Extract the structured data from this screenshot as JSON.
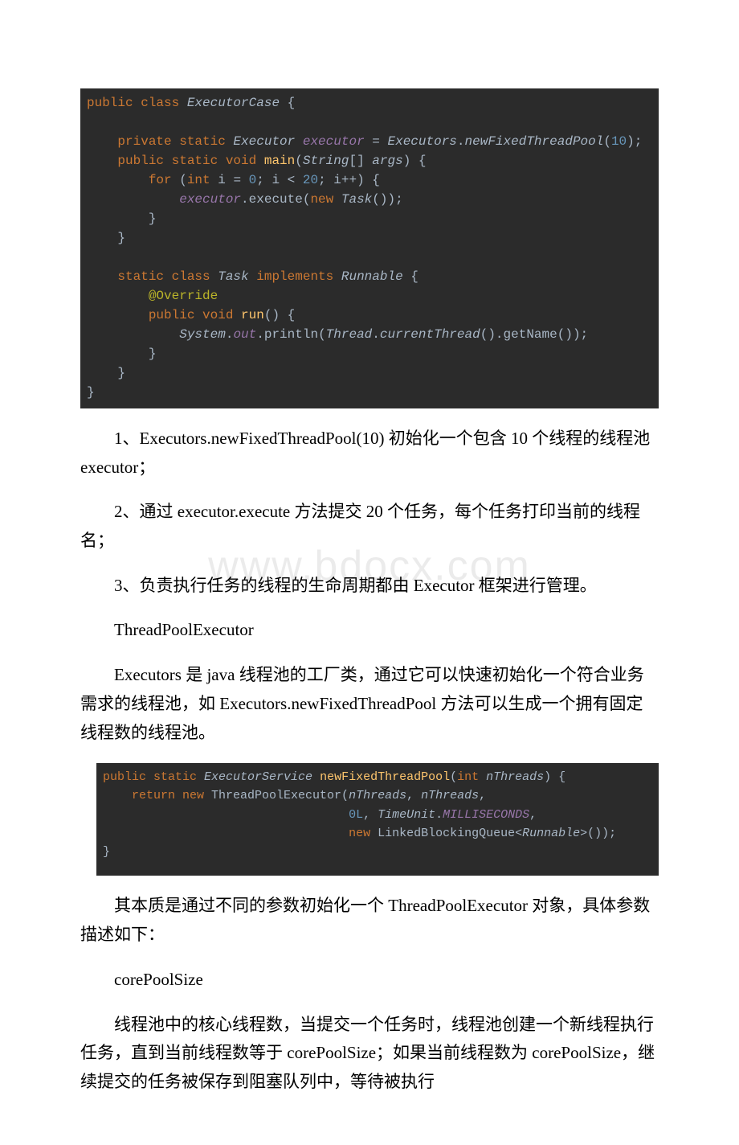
{
  "watermark": "www.bdocx.com",
  "code1": {
    "l1_kw": "public class",
    "l1_cls": " ExecutorCase",
    "l1_rest": " {",
    "l3_kw1": "private static",
    "l3_type": " Executor",
    "l3_var": " executor",
    "l3_eq": " = ",
    "l3_cls": "Executors",
    "l3_dot": ".",
    "l3_method": "newFixedThreadPool",
    "l3_args": "(",
    "l3_num": "10",
    "l3_end": ");",
    "l4_kw": "public static void",
    "l4_method": " main",
    "l4_args1": "(",
    "l4_type": "String",
    "l4_args2": "[] ",
    "l4_var": "args",
    "l4_args3": ") {",
    "l5_kw": "for",
    "l5_a": " (",
    "l5_kw2": "int",
    "l5_b": " i = ",
    "l5_n0": "0",
    "l5_c": "; i < ",
    "l5_n20": "20",
    "l5_d": "; i++) {",
    "l6_a": "executor",
    "l6_b": ".execute(",
    "l6_kw": "new",
    "l6_c": " ",
    "l6_type": "Task",
    "l6_d": "());",
    "l7": "}",
    "l8": "}",
    "l10_kw": "static class",
    "l10_cls": " Task",
    "l10_kw2": " implements",
    "l10_intf": " Runnable",
    "l10_rest": " {",
    "l11": "@Override",
    "l12_kw": "public void",
    "l12_method": " run",
    "l12_rest": "() {",
    "l13_cls": "System",
    "l13_a": ".",
    "l13_out": "out",
    "l13_b": ".println(",
    "l13_th": "Thread",
    "l13_c": ".",
    "l13_ct": "currentThread",
    "l13_d": "().getName());",
    "l14": "}",
    "l15": "}",
    "l16": "}"
  },
  "para1": "1、Executors.newFixedThreadPool(10) 初始化一个包含 10 个线程的线程池 executor；",
  "para2": "2、通过 executor.execute 方法提交 20 个任务，每个任务打印当前的线程名；",
  "para3": "3、负责执行任务的线程的生命周期都由 Executor 框架进行管理。",
  "heading1": "ThreadPoolExecutor",
  "para4": "Executors 是 java 线程池的工厂类，通过它可以快速初始化一个符合业务需求的线程池，如 Executors.newFixedThreadPool 方法可以生成一个拥有固定线程数的线程池。",
  "code2": {
    "l1_kw": "public static",
    "l1_type": " ExecutorService",
    "l1_method": " newFixedThreadPool",
    "l1_a": "(",
    "l1_kw2": "int",
    "l1_var": " nThreads",
    "l1_b": ") {",
    "l2_kw": "return new",
    "l2_rest": " ThreadPoolExecutor(",
    "l2_arg1": "nThreads",
    "l2_c": ", ",
    "l2_arg2": "nThreads",
    "l2_d": ",",
    "l3_num": "0L",
    "l3_a": ", ",
    "l3_type": "TimeUnit",
    "l3_b": ".",
    "l3_const": "MILLISECONDS",
    "l3_c": ",",
    "l4_kw": "new",
    "l4_a": " LinkedBlockingQueue<",
    "l4_type": "Runnable",
    "l4_b": ">());",
    "l5": "}"
  },
  "para5": "其本质是通过不同的参数初始化一个 ThreadPoolExecutor 对象，具体参数描述如下：",
  "heading2": "corePoolSize",
  "para6": "线程池中的核心线程数，当提交一个任务时，线程池创建一个新线程执行任务，直到当前线程数等于 corePoolSize；如果当前线程数为 corePoolSize，继续提交的任务被保存到阻塞队列中，等待被执行"
}
